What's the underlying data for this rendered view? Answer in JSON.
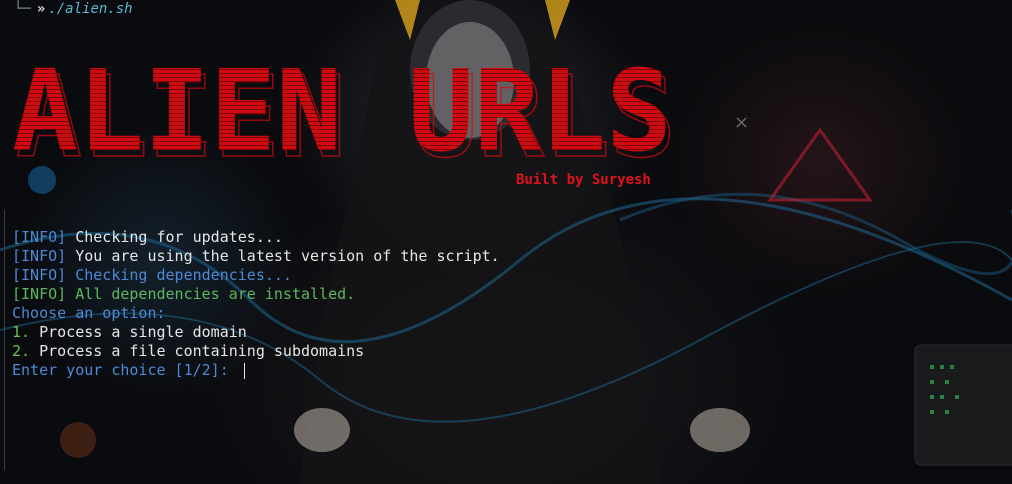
{
  "prompt": {
    "arrow": "»",
    "command": "./alien.sh"
  },
  "banner": {
    "title": "ALIEN URLS",
    "byline": "Built by Suryesh"
  },
  "log": [
    {
      "tag": "[INFO]",
      "text": " Checking for updates..."
    },
    {
      "tag": "[INFO]",
      "text": " You are using the latest version of the script."
    },
    {
      "tag": "[INFO]",
      "text": " Checking dependencies..."
    },
    {
      "tag": "[INFO]",
      "text": " All dependencies are installed."
    }
  ],
  "menu": {
    "heading": "Choose an option:",
    "options": [
      {
        "num": "1.",
        "label": " Process a single domain"
      },
      {
        "num": "2.",
        "label": " Process a file containing subdomains"
      }
    ],
    "input_prompt": "Enter your choice [1/2]: "
  },
  "colors": {
    "accent_red": "#d10a10",
    "info_blue": "#4c8ad6",
    "success_green": "#5cb85c"
  }
}
